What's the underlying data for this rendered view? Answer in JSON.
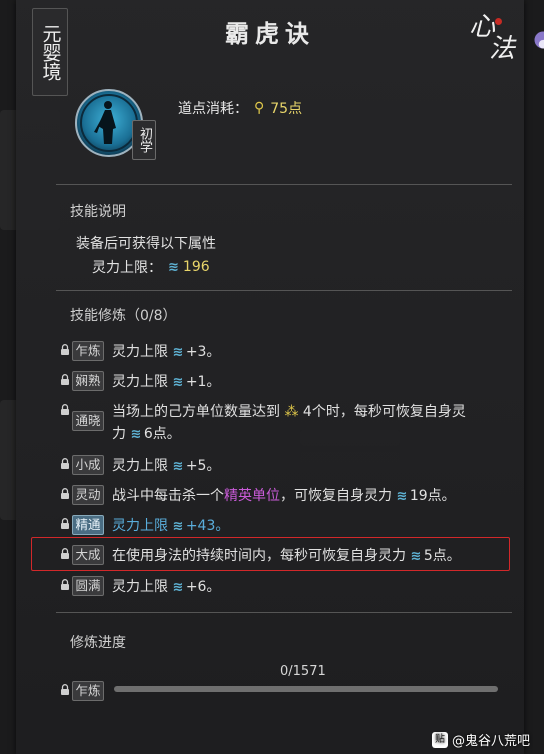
{
  "panel": {
    "realm": "元婴境",
    "title": "霸虎诀",
    "category_calligraphy": [
      "心",
      "法"
    ],
    "skill_tier": "初学",
    "cost_label": "道点消耗：",
    "cost_value": "75点"
  },
  "description": {
    "heading": "技能说明",
    "line1": "装备后可获得以下属性",
    "attr_label": "灵力上限：",
    "attr_value": "196"
  },
  "training": {
    "heading": "技能修炼（0/8）",
    "rows": [
      {
        "tag": "乍炼",
        "text_a": "灵力上限",
        "text_b": "+3。"
      },
      {
        "tag": "娴熟",
        "text_a": "灵力上限",
        "text_b": "+1。"
      },
      {
        "tag": "通晓",
        "text_a": "当场上的己方单位数量达到",
        "text_b": "4个时，每秒可恢复自身灵",
        "text_c": "力",
        "text_d": "6点。"
      },
      {
        "tag": "小成",
        "text_a": "灵力上限",
        "text_b": "+5。"
      },
      {
        "tag": "灵动",
        "text_a": "战斗中每击杀一个",
        "text_hl": "精英单位",
        "text_b": "，可恢复自身灵力",
        "text_c": "19点。"
      },
      {
        "tag": "精通",
        "text_a": "灵力上限",
        "text_b": "+43。"
      },
      {
        "tag": "大成",
        "text_a": "在使用身法的持续时间内，每秒可恢复自身灵力",
        "text_b": "5点。"
      },
      {
        "tag": "圆满",
        "text_a": "灵力上限",
        "text_b": "+6。"
      }
    ]
  },
  "progress": {
    "heading": "修炼进度",
    "value_text": "0/1571",
    "fraction": 0.0,
    "stage_tag": "乍炼"
  },
  "watermark": {
    "text": "@鬼谷八荒吧",
    "icon": "paw-icon"
  },
  "colors": {
    "accent_gold": "#e8d56a",
    "spirit_blue": "#5fb4d6",
    "elite_purple": "#c95bd8",
    "highlight_red": "#d2282a"
  }
}
